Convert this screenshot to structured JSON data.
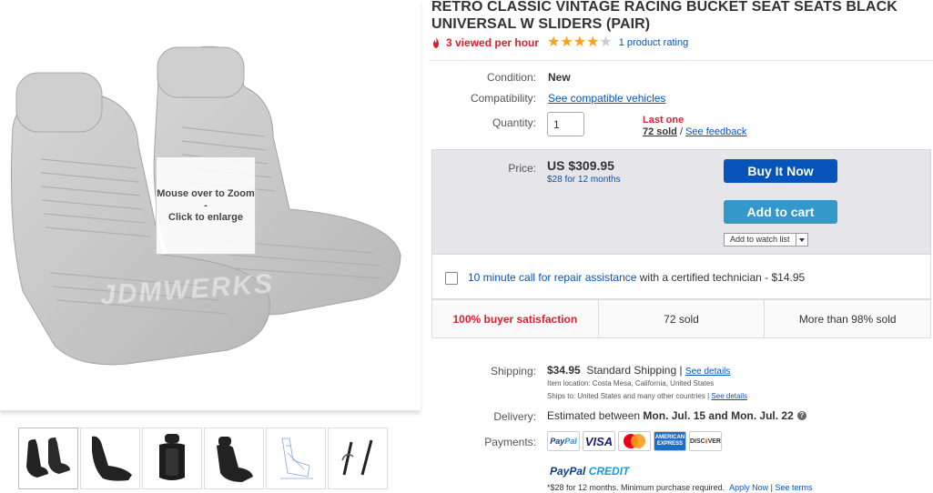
{
  "listing": {
    "title": "RETRO CLASSIC VINTAGE RACING BUCKET SEAT SEATS BLACK UNIVERSAL W SLIDERS (PAIR)",
    "viewed": "3 viewed per hour",
    "rating_stars": 4,
    "rating_link": "1 product rating"
  },
  "media": {
    "zoom_line1": "Mouse over to Zoom",
    "zoom_line2": "-",
    "zoom_line3": "Click to enlarge",
    "watermark": "JDMWERKS",
    "thumbnails": [
      "seat-pair-thumb",
      "seat-side-thumb",
      "seat-front-thumb",
      "seat-angle-thumb",
      "seat-diagram-thumb",
      "slider-rails-thumb"
    ]
  },
  "details": {
    "condition_label": "Condition:",
    "condition_value": "New",
    "compat_label": "Compatibility:",
    "compat_link": "See compatible vehicles",
    "qty_label": "Quantity:",
    "qty_value": "1",
    "last_one": "Last one",
    "sold_count": "72 sold",
    "sold_sep": " / ",
    "feedback_link": "See feedback"
  },
  "purchase": {
    "price_label": "Price:",
    "price": "US $309.95",
    "financing": "$28 for 12 months",
    "buy_now": "Buy It Now",
    "add_to_cart": "Add to cart",
    "watch": "Add to watch list"
  },
  "repair": {
    "link": "10 minute call for repair assistance",
    "rest": " with a certified technician - $14.95"
  },
  "stats": {
    "satisfaction": "100% buyer satisfaction",
    "sold": "72 sold",
    "more": "More than 98% sold"
  },
  "shipping": {
    "label": "Shipping:",
    "cost": "$34.95",
    "method": "Standard Shipping | ",
    "details_link": "See details",
    "item_location": "Item location:  Costa Mesa, California, United States",
    "ships_to": "Ships to:  United States and many other countries | ",
    "ships_link": "See details"
  },
  "delivery": {
    "label": "Delivery:",
    "prefix": "Estimated between ",
    "dates": "Mon. Jul. 15 and Mon. Jul. 22"
  },
  "payments": {
    "label": "Payments:",
    "methods": [
      "PayPal",
      "VISA",
      "MasterCard",
      "American Express",
      "DISCOVER"
    ]
  },
  "paypal_credit": {
    "logo_pp": "PayPal",
    "logo_cr": " CREDIT",
    "fine": "*$28 for 12 months. Minimum purchase required.",
    "apply": "Apply Now",
    "sep": " | ",
    "terms": "See terms"
  },
  "colors": {
    "link": "#0654ba",
    "alert": "#dd1e31",
    "buy_button": "#0654ba",
    "cart_button": "#3498ca",
    "star": "#f7a022"
  }
}
